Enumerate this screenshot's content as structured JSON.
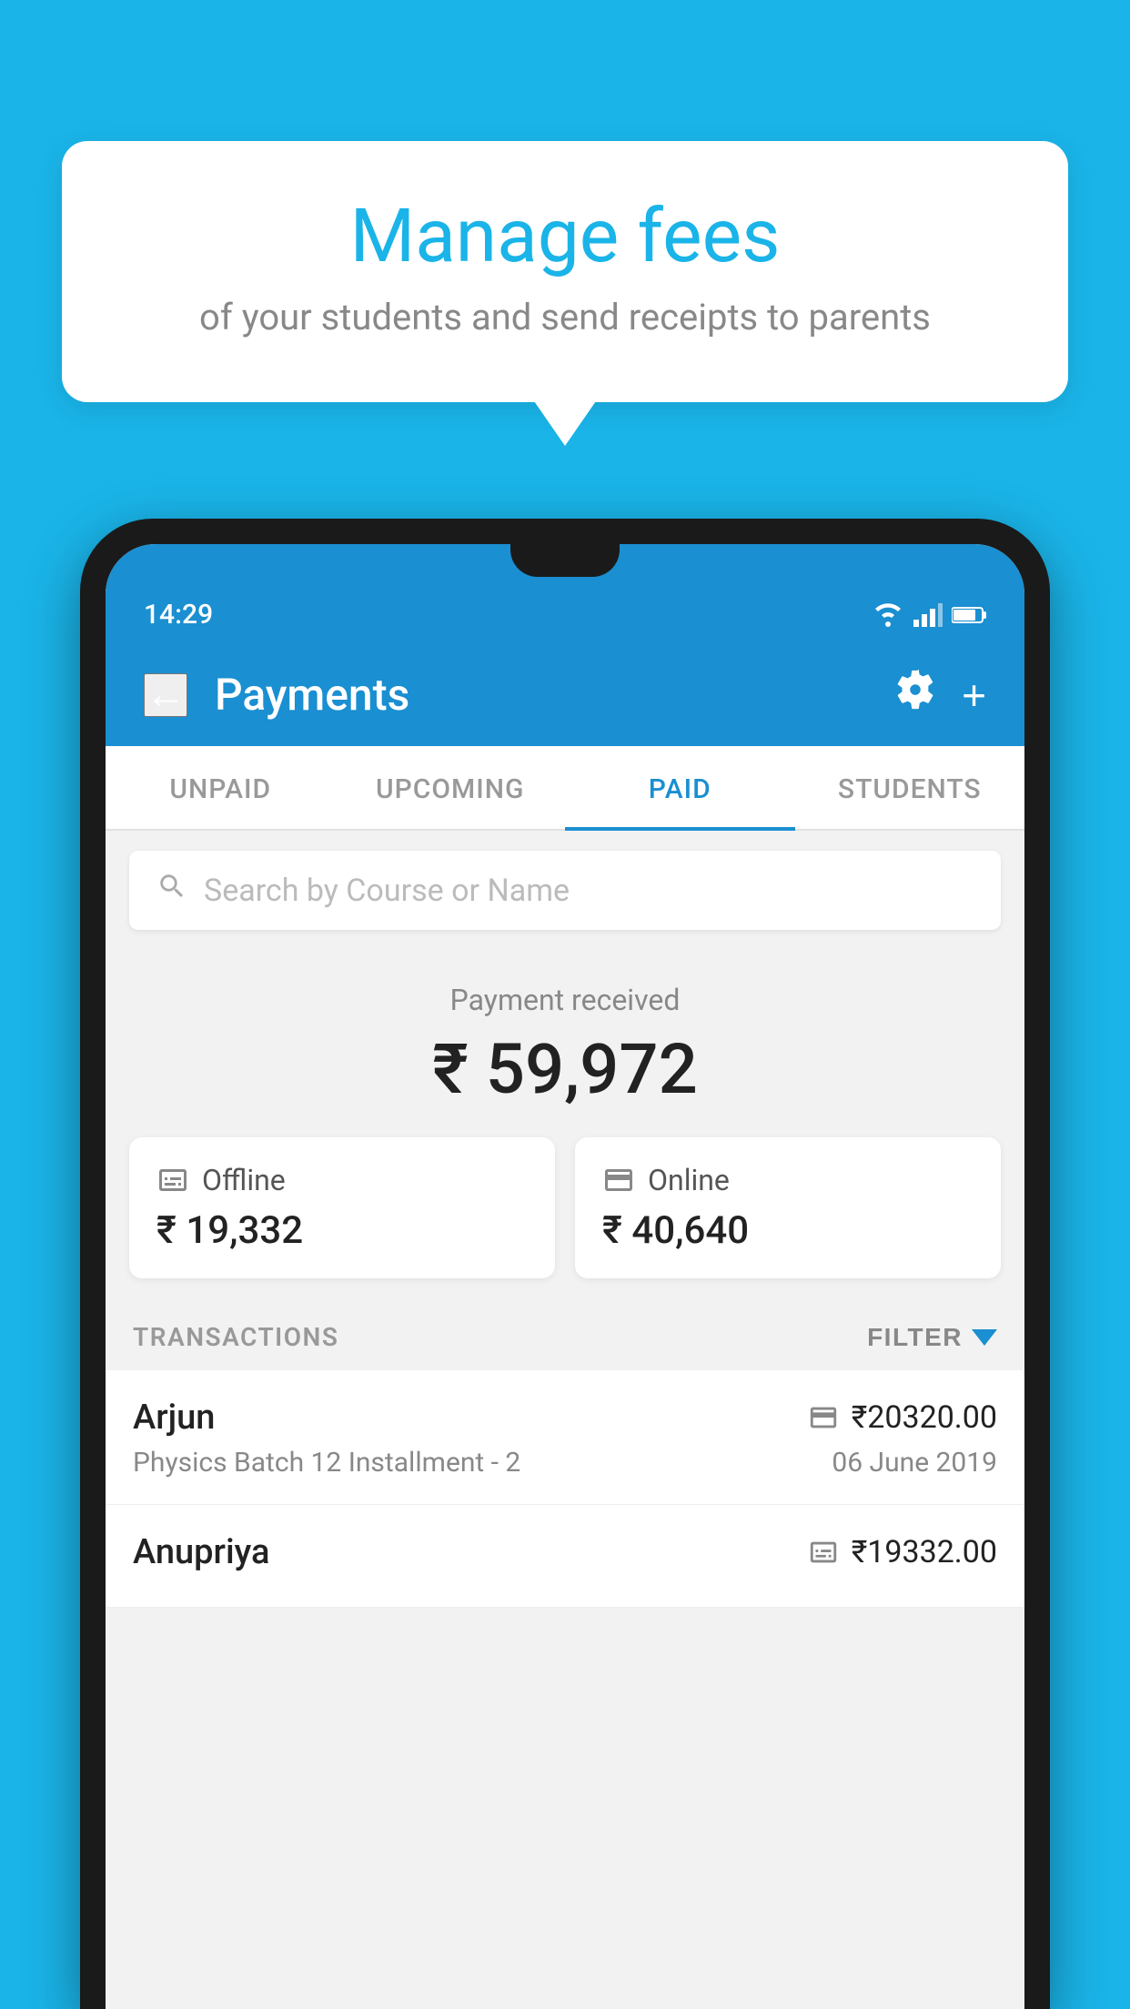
{
  "background_color": "#1ab4e8",
  "bubble": {
    "title": "Manage fees",
    "subtitle": "of your students and send receipts to parents"
  },
  "status_bar": {
    "time": "14:29"
  },
  "header": {
    "title": "Payments",
    "back_label": "←",
    "plus_label": "+"
  },
  "tabs": [
    {
      "label": "UNPAID",
      "active": false
    },
    {
      "label": "UPCOMING",
      "active": false
    },
    {
      "label": "PAID",
      "active": true
    },
    {
      "label": "STUDENTS",
      "active": false
    }
  ],
  "search": {
    "placeholder": "Search by Course or Name"
  },
  "payment_received": {
    "label": "Payment received",
    "amount": "₹ 59,972"
  },
  "payment_cards": [
    {
      "type": "Offline",
      "amount": "₹ 19,332",
      "icon": "offline"
    },
    {
      "type": "Online",
      "amount": "₹ 40,640",
      "icon": "online"
    }
  ],
  "transactions_section": {
    "label": "TRANSACTIONS",
    "filter_label": "FILTER"
  },
  "transactions": [
    {
      "name": "Arjun",
      "course": "Physics Batch 12 Installment - 2",
      "amount": "₹20320.00",
      "date": "06 June 2019",
      "payment_type": "online"
    },
    {
      "name": "Anupriya",
      "course": "",
      "amount": "₹19332.00",
      "date": "",
      "payment_type": "offline"
    }
  ]
}
